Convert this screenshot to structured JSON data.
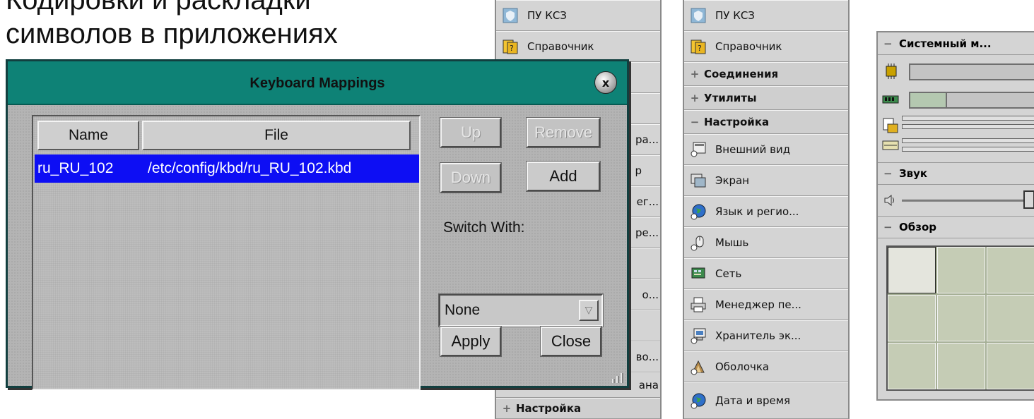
{
  "caption": {
    "line1": "Кодировки и раскладки",
    "line2": "символов в приложениях"
  },
  "dialog": {
    "title": "Keyboard Mappings",
    "close_glyph": "x",
    "columns": [
      "Name",
      "File"
    ],
    "rows": [
      {
        "name": "ru_RU_102",
        "file": "/etc/config/kbd/ru_RU_102.kbd",
        "selected": true
      }
    ],
    "buttons": {
      "up": "Up",
      "remove": "Remove",
      "down": "Down",
      "add": "Add",
      "apply": "Apply",
      "close": "Close"
    },
    "switch_with_label": "Switch With:",
    "switch_with_value": "None"
  },
  "panel_left": {
    "visible_fragments": [
      "ра...",
      "р",
      "ег...",
      "ре...",
      "о...",
      "во...",
      "ана"
    ],
    "items": [
      {
        "label": "ПУ КСЗ",
        "icon": "shield-icon"
      },
      {
        "label": "Справочник",
        "icon": "help-book-icon"
      }
    ],
    "footer": {
      "label": "Настройка",
      "sign": "+"
    }
  },
  "panel_mid": {
    "items": [
      {
        "label": "ПУ КСЗ",
        "icon": "shield-icon",
        "type": "item"
      },
      {
        "label": "Справочник",
        "icon": "help-book-icon",
        "type": "item"
      },
      {
        "label": "Соединения",
        "sign": "+",
        "type": "header"
      },
      {
        "label": "Утилиты",
        "sign": "+",
        "type": "header"
      },
      {
        "label": "Настройка",
        "sign": "−",
        "type": "header"
      },
      {
        "label": "Внешний вид",
        "icon": "appearance-icon",
        "type": "item"
      },
      {
        "label": "Экран",
        "icon": "display-icon",
        "type": "item"
      },
      {
        "label": "Язык и регио...",
        "icon": "globe-icon",
        "type": "item"
      },
      {
        "label": "Мышь",
        "icon": "mouse-icon",
        "type": "item"
      },
      {
        "label": "Сеть",
        "icon": "network-icon",
        "type": "item"
      },
      {
        "label": "Менеджер пе...",
        "icon": "printer-icon",
        "type": "item"
      },
      {
        "label": "Хранитель эк...",
        "icon": "screensaver-icon",
        "type": "item"
      },
      {
        "label": "Оболочка",
        "icon": "shell-icon",
        "type": "item"
      },
      {
        "label": "Дата и время",
        "icon": "clock-globe-icon",
        "type": "item"
      }
    ]
  },
  "sysmon": {
    "title": "Системный м...",
    "sign_minus": "−",
    "sound_title": "Звук",
    "overview_title": "Обзор",
    "cpu_level": 0.0,
    "mem_level": 0.2,
    "volume_level": 0.85
  }
}
